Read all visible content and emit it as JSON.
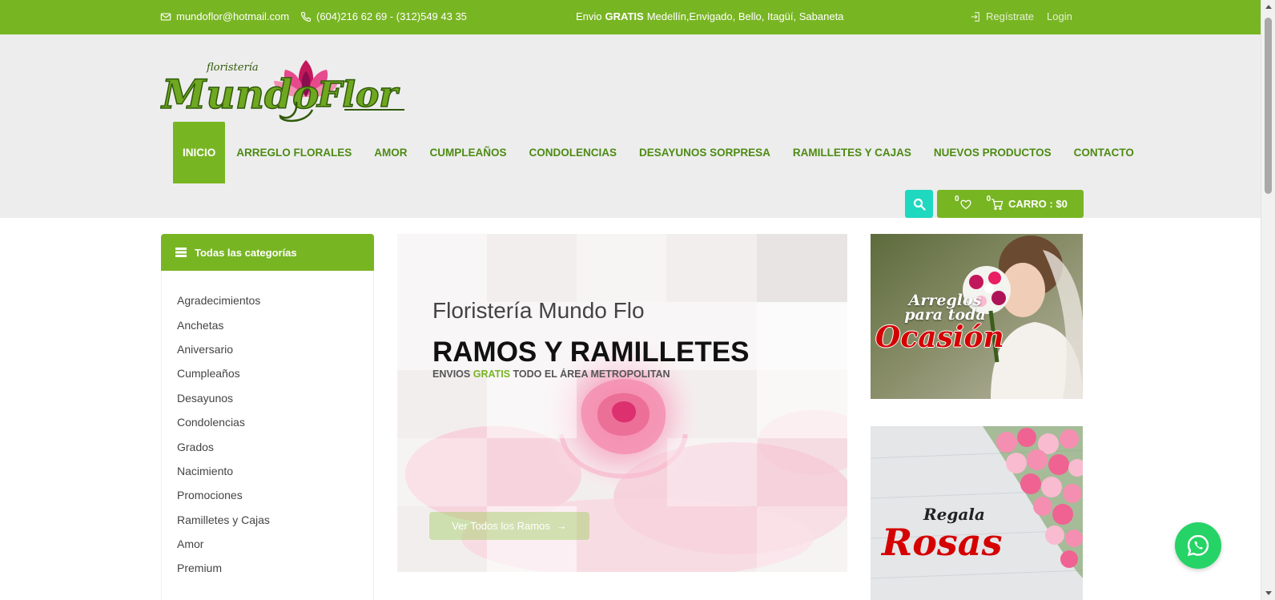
{
  "topbar": {
    "email": "mundoflor@hotmail.com",
    "phone": "(604)216 62 69 - (312)549 43 35",
    "shipping_prefix": "Envio",
    "shipping_bold": "GRATIS",
    "shipping_rest": "Medellín,Envigado, Bello, Itagüí, Sabaneta",
    "register": "Regístrate",
    "login": "Login"
  },
  "logo": {
    "small": "floristería",
    "main": "Mundo",
    "main2": "Flor"
  },
  "nav": {
    "items": [
      "INICIO",
      "ARREGLO FLORALES",
      "AMOR",
      "CUMPLEAÑOS",
      "CONDOLENCIAS",
      "DESAYUNOS SORPRESA",
      "RAMILLETES Y CAJAS",
      "NUEVOS PRODUCTOS",
      "CONTACTO"
    ]
  },
  "cart": {
    "wishlist_count": "0",
    "cart_count": "0",
    "label": "CARRO : $0"
  },
  "sidebar": {
    "title": "Todas las categorías",
    "categories": [
      "Agradecimientos",
      "Anchetas",
      "Aniversario",
      "Cumpleaños",
      "Desayunos",
      "Condolencias",
      "Grados",
      "Nacimiento",
      "Promociones",
      "Ramilletes y Cajas",
      "Amor",
      "Premium"
    ]
  },
  "hero": {
    "heading": "Floristería Mundo Flo",
    "title": "RAMOS Y RAMILLETES",
    "sub_prefix": "ENVIOS",
    "sub_green": "GRATIS",
    "sub_rest": "TODO EL ÁREA METROPOLITAN",
    "cta": "Ver Todos los Ramos",
    "cta_arrow": "→"
  },
  "banners": {
    "b1_line1": "Arreglos",
    "b1_line2": "para toda",
    "b1_line3": "Ocasión",
    "b2_line1": "Regala",
    "b2_line2": "Rosas"
  },
  "colors": {
    "brand_green": "#78b523",
    "nav_green": "#4d8b13",
    "search_teal": "#1fd8c0",
    "whatsapp": "#25d366"
  },
  "icons": [
    "mail-icon",
    "phone-icon",
    "login-icon",
    "search-icon",
    "heart-icon",
    "cart-icon",
    "menu-icon",
    "arrow-right-icon",
    "whatsapp-icon"
  ]
}
